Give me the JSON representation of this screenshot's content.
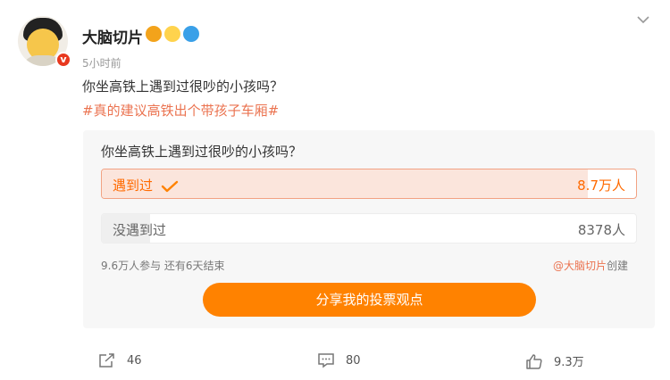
{
  "user": {
    "name": "大脑切片",
    "time": "5小时前",
    "verified_icon": "v-badge",
    "badges": [
      "crown-badge-icon",
      "duck-badge-icon",
      "balloon-badge-icon"
    ]
  },
  "post": {
    "text": "你坐高铁上遇到过很吵的小孩吗？",
    "hashtag": "#真的建议高铁出个带孩子车厢#"
  },
  "poll": {
    "question": "你坐高铁上遇到过很吵的小孩吗？",
    "options": [
      {
        "label": "遇到过",
        "count": "8.7万人",
        "selected": true,
        "share": 0.91
      },
      {
        "label": "没遇到过",
        "count": "8378人",
        "selected": false,
        "share": 0.09
      }
    ],
    "meta": "9.6万人参与 还有6天结束",
    "creator_name": "@大脑切片",
    "creator_suffix": "创建",
    "share_button": "分享我的投票观点"
  },
  "footer": {
    "repost_count": "46",
    "comment_count": "80",
    "like_count": "9.3万"
  },
  "colors": {
    "accent": "#ff8200",
    "hashtag": "#eb7350",
    "selected_text": "#ff6a00"
  }
}
